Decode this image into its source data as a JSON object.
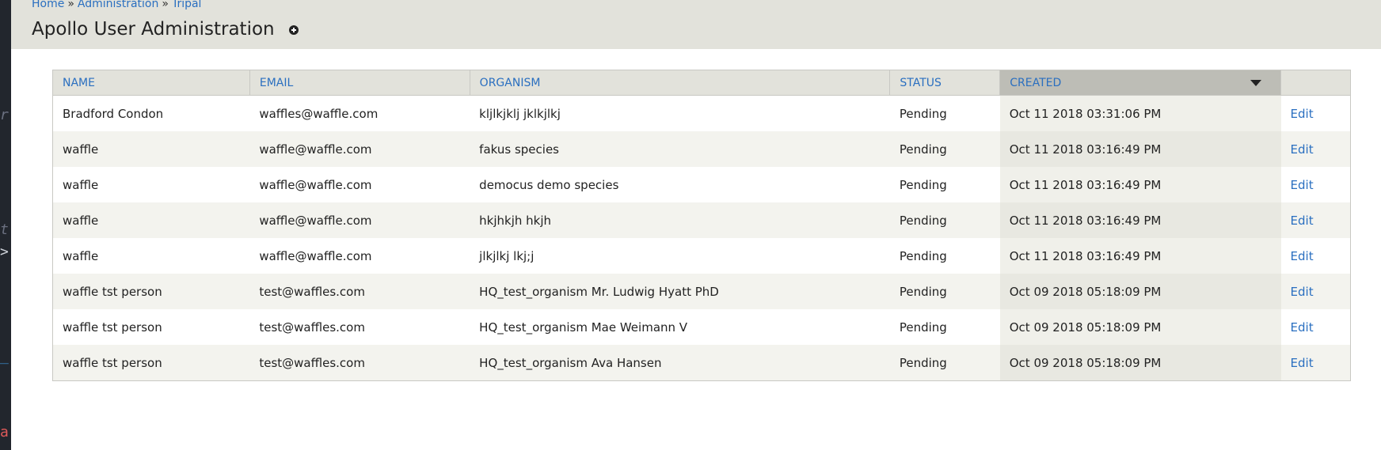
{
  "breadcrumb": {
    "items": [
      "Home",
      "Administration",
      "Tripal"
    ],
    "separator": "»"
  },
  "page": {
    "title": "Apollo User Administration"
  },
  "table": {
    "columns": [
      "NAME",
      "EMAIL",
      "ORGANISM",
      "STATUS",
      "CREATED",
      ""
    ],
    "sorted_column": "CREATED",
    "sort_direction": "descending",
    "rows": [
      {
        "name": "Bradford Condon",
        "email": "waffles@waffle.com",
        "organism": "kljlkjklj jklkjlkj",
        "status": "Pending",
        "created": "Oct 11 2018 03:31:06 PM",
        "action": "Edit"
      },
      {
        "name": "waffle",
        "email": "waffle@waffle.com",
        "organism": "fakus species",
        "status": "Pending",
        "created": "Oct 11 2018 03:16:49 PM",
        "action": "Edit"
      },
      {
        "name": "waffle",
        "email": "waffle@waffle.com",
        "organism": "democus demo species",
        "status": "Pending",
        "created": "Oct 11 2018 03:16:49 PM",
        "action": "Edit"
      },
      {
        "name": "waffle",
        "email": "waffle@waffle.com",
        "organism": "hkjhkjh hkjh",
        "status": "Pending",
        "created": "Oct 11 2018 03:16:49 PM",
        "action": "Edit"
      },
      {
        "name": "waffle",
        "email": "waffle@waffle.com",
        "organism": "jlkjlkj lkj;j",
        "status": "Pending",
        "created": "Oct 11 2018 03:16:49 PM",
        "action": "Edit"
      },
      {
        "name": "waffle tst person",
        "email": "test@waffles.com",
        "organism": "HQ_test_organism Mr. Ludwig Hyatt PhD",
        "status": "Pending",
        "created": "Oct 09 2018 05:18:09 PM",
        "action": "Edit"
      },
      {
        "name": "waffle tst person",
        "email": "test@waffles.com",
        "organism": "HQ_test_organism Mae Weimann V",
        "status": "Pending",
        "created": "Oct 09 2018 05:18:09 PM",
        "action": "Edit"
      },
      {
        "name": "waffle tst person",
        "email": "test@waffles.com",
        "organism": "HQ_test_organism Ava Hansen",
        "status": "Pending",
        "created": "Oct 09 2018 05:18:09 PM",
        "action": "Edit"
      }
    ]
  },
  "icons": {
    "add": "add-circle-icon",
    "sort": "sort-desc-icon"
  },
  "colors": {
    "link": "#2a6fc0",
    "header_bg": "#e2e2db",
    "active_sort_bg": "#bdbdb6",
    "editor_strip": "#22262d"
  }
}
